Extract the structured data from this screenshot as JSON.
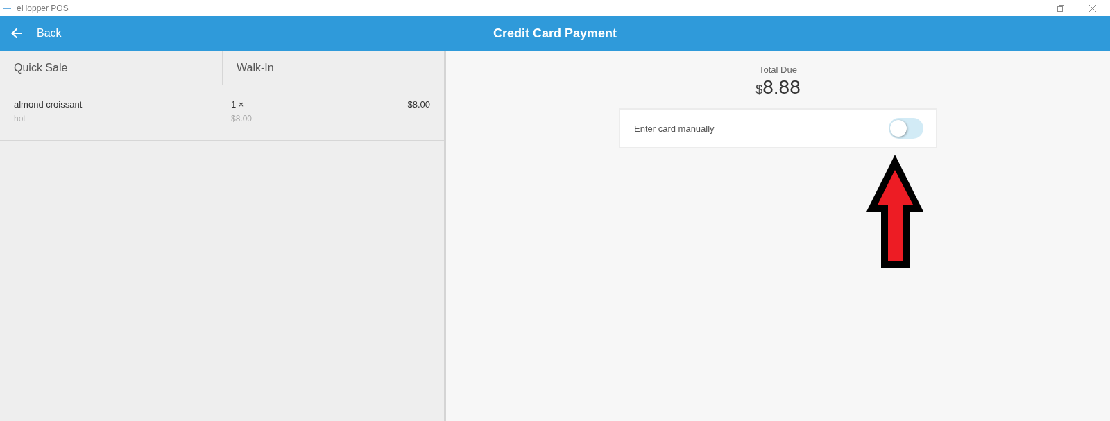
{
  "window": {
    "title": "eHopper POS"
  },
  "header": {
    "back_label": "Back",
    "title": "Credit Card Payment"
  },
  "order": {
    "columns": [
      "Quick Sale",
      "Walk-In"
    ],
    "items": [
      {
        "name": "almond croissant",
        "note": "hot",
        "quantity": "1 ×",
        "unit_price": "$8.00",
        "total": "$8.00"
      }
    ]
  },
  "payment": {
    "total_label": "Total Due",
    "currency": "$",
    "amount": "8.88",
    "manual_entry": {
      "label": "Enter card manually",
      "on": false
    }
  }
}
